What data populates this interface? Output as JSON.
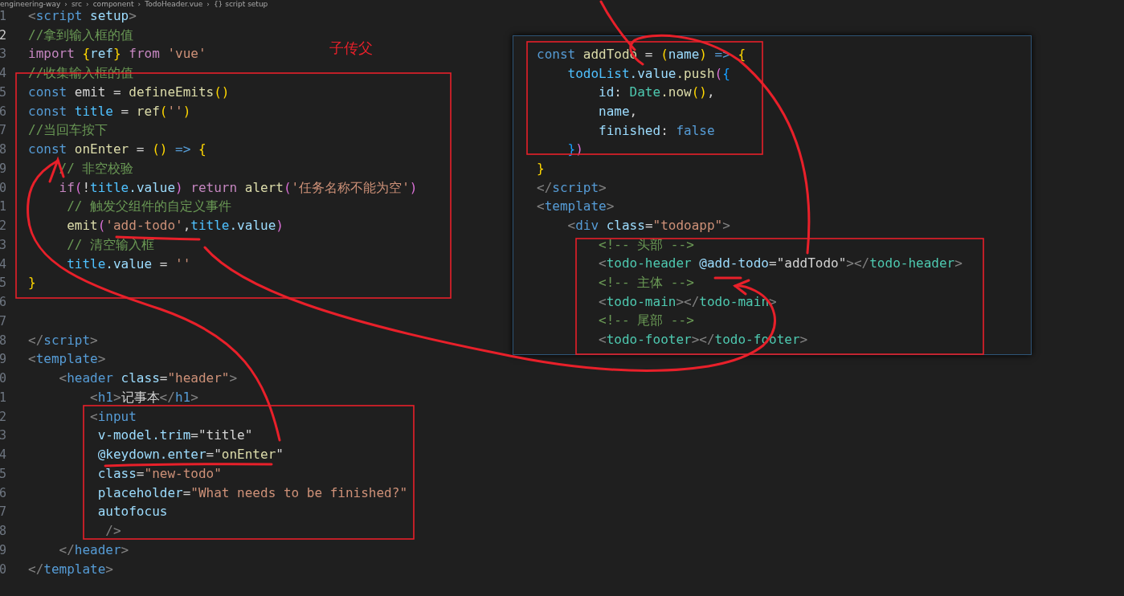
{
  "breadcrumb": {
    "separator": "›",
    "items": [
      "engineering-way",
      "src",
      "component",
      "TodoHeader.vue",
      "{} script setup"
    ]
  },
  "editor": {
    "lines": [
      {
        "n": "1",
        "tokens": [
          {
            "t": "<",
            "color": "#808080"
          },
          {
            "t": "script",
            "color": "#569cd6"
          },
          {
            "t": " setup",
            "color": "#9cdcfe"
          },
          {
            "t": ">",
            "color": "#808080"
          }
        ]
      },
      {
        "n": "2",
        "tokens": [
          {
            "t": "//拿到输入框的值",
            "color": "#6a9955"
          }
        ]
      },
      {
        "n": "3",
        "tokens": [
          {
            "t": "import",
            "color": "#c586c0"
          },
          {
            "t": " {",
            "color": "#ffd700"
          },
          {
            "t": "ref",
            "color": "#9cdcfe"
          },
          {
            "t": "}",
            "color": "#ffd700"
          },
          {
            "t": " from",
            "color": "#c586c0"
          },
          {
            "t": " 'vue'",
            "color": "#ce9178"
          }
        ]
      },
      {
        "n": "4",
        "tokens": [
          {
            "t": "//收集输入框的值",
            "color": "#6a9955"
          }
        ]
      },
      {
        "n": "5",
        "tokens": [
          {
            "t": "const",
            "color": "#569cd6"
          },
          {
            "t": " emit =",
            "color": "#d4d4d4"
          },
          {
            "t": " defineEmits",
            "color": "#dcdcaa"
          },
          {
            "t": "()",
            "color": "#ffd700"
          }
        ]
      },
      {
        "n": "6",
        "tokens": [
          {
            "t": "const",
            "color": "#569cd6"
          },
          {
            "t": " title",
            "color": "#4fc1ff"
          },
          {
            "t": " =",
            "color": "#d4d4d4"
          },
          {
            "t": " ref",
            "color": "#dcdcaa"
          },
          {
            "t": "(",
            "color": "#ffd700"
          },
          {
            "t": "''",
            "color": "#ce9178"
          },
          {
            "t": ")",
            "color": "#ffd700"
          }
        ]
      },
      {
        "n": "7",
        "tokens": [
          {
            "t": "//当回车按下",
            "color": "#6a9955"
          }
        ]
      },
      {
        "n": "8",
        "tokens": [
          {
            "t": "const",
            "color": "#569cd6"
          },
          {
            "t": " onEnter",
            "color": "#dcdcaa"
          },
          {
            "t": " =",
            "color": "#d4d4d4"
          },
          {
            "t": " ()",
            "color": "#ffd700"
          },
          {
            "t": " =>",
            "color": "#569cd6"
          },
          {
            "t": " {",
            "color": "#ffd700"
          }
        ]
      },
      {
        "n": "9",
        "tokens": [
          {
            "t": "    // 非空校验",
            "color": "#6a9955"
          }
        ]
      },
      {
        "n": "0",
        "tokens": [
          {
            "t": "    if",
            "color": "#c586c0"
          },
          {
            "t": "(",
            "color": "#da70d6"
          },
          {
            "t": "!",
            "color": "#d4d4d4"
          },
          {
            "t": "title",
            "color": "#4fc1ff"
          },
          {
            "t": ".value",
            "color": "#9cdcfe"
          },
          {
            "t": ")",
            "color": "#da70d6"
          },
          {
            "t": " return",
            "color": "#c586c0"
          },
          {
            "t": " alert",
            "color": "#dcdcaa"
          },
          {
            "t": "(",
            "color": "#da70d6"
          },
          {
            "t": "'任务名称不能为空'",
            "color": "#ce9178"
          },
          {
            "t": ")",
            "color": "#da70d6"
          }
        ]
      },
      {
        "n": "1",
        "tokens": [
          {
            "t": "     // 触发父组件的自定义事件",
            "color": "#6a9955"
          }
        ]
      },
      {
        "n": "2",
        "tokens": [
          {
            "t": "     emit",
            "color": "#dcdcaa"
          },
          {
            "t": "(",
            "color": "#da70d6"
          },
          {
            "t": "'add-todo'",
            "color": "#ce9178"
          },
          {
            "t": ",",
            "color": "#d4d4d4"
          },
          {
            "t": "title",
            "color": "#4fc1ff"
          },
          {
            "t": ".value",
            "color": "#9cdcfe"
          },
          {
            "t": ")",
            "color": "#da70d6"
          }
        ]
      },
      {
        "n": "3",
        "tokens": [
          {
            "t": "     // 清空输入框",
            "color": "#6a9955"
          }
        ]
      },
      {
        "n": "4",
        "tokens": [
          {
            "t": "     title",
            "color": "#4fc1ff"
          },
          {
            "t": ".value",
            "color": "#9cdcfe"
          },
          {
            "t": " =",
            "color": "#d4d4d4"
          },
          {
            "t": " ''",
            "color": "#ce9178"
          }
        ]
      },
      {
        "n": "5",
        "tokens": [
          {
            "t": "}",
            "color": "#ffd700"
          }
        ]
      },
      {
        "n": "6"
      },
      {
        "n": "7"
      },
      {
        "n": "8",
        "tokens": [
          {
            "t": "</",
            "color": "#808080"
          },
          {
            "t": "script",
            "color": "#569cd6"
          },
          {
            "t": ">",
            "color": "#808080"
          }
        ]
      },
      {
        "n": "9",
        "tokens": [
          {
            "t": "<",
            "color": "#808080"
          },
          {
            "t": "template",
            "color": "#569cd6"
          },
          {
            "t": ">",
            "color": "#808080"
          }
        ]
      },
      {
        "n": "0",
        "tokens": [
          {
            "t": "    <",
            "color": "#808080"
          },
          {
            "t": "header",
            "color": "#569cd6"
          },
          {
            "t": " class",
            "color": "#9cdcfe"
          },
          {
            "t": "=",
            "color": "#d4d4d4"
          },
          {
            "t": "\"header\"",
            "color": "#ce9178"
          },
          {
            "t": ">",
            "color": "#808080"
          }
        ]
      },
      {
        "n": "1",
        "tokens": [
          {
            "t": "        <",
            "color": "#808080"
          },
          {
            "t": "h1",
            "color": "#569cd6"
          },
          {
            "t": ">",
            "color": "#808080"
          },
          {
            "t": "记事本",
            "color": "#d4d4d4"
          },
          {
            "t": "</",
            "color": "#808080"
          },
          {
            "t": "h1",
            "color": "#569cd6"
          },
          {
            "t": ">",
            "color": "#808080"
          }
        ]
      },
      {
        "n": "2",
        "tokens": [
          {
            "t": "        <",
            "color": "#808080"
          },
          {
            "t": "input",
            "color": "#569cd6"
          }
        ]
      },
      {
        "n": "3",
        "tokens": [
          {
            "t": "         v-model.trim",
            "color": "#9cdcfe"
          },
          {
            "t": "=\"title\"",
            "color": "#d4d4d4"
          }
        ]
      },
      {
        "n": "4",
        "tokens": [
          {
            "t": "         @keydown.enter",
            "color": "#9cdcfe"
          },
          {
            "t": "=\"",
            "color": "#d4d4d4"
          },
          {
            "t": "onEnter",
            "color": "#dcdcaa"
          },
          {
            "t": "\"",
            "color": "#d4d4d4"
          }
        ]
      },
      {
        "n": "5",
        "tokens": [
          {
            "t": "         class",
            "color": "#9cdcfe"
          },
          {
            "t": "=",
            "color": "#d4d4d4"
          },
          {
            "t": "\"new-todo\"",
            "color": "#ce9178"
          }
        ]
      },
      {
        "n": "6",
        "tokens": [
          {
            "t": "         placeholder",
            "color": "#9cdcfe"
          },
          {
            "t": "=",
            "color": "#d4d4d4"
          },
          {
            "t": "\"What needs to be finished?\"",
            "color": "#ce9178"
          }
        ]
      },
      {
        "n": "7",
        "tokens": [
          {
            "t": "         autofocus",
            "color": "#9cdcfe"
          }
        ]
      },
      {
        "n": "8",
        "tokens": [
          {
            "t": "          />",
            "color": "#808080"
          }
        ]
      },
      {
        "n": "9",
        "tokens": [
          {
            "t": "    </",
            "color": "#808080"
          },
          {
            "t": "header",
            "color": "#569cd6"
          },
          {
            "t": ">",
            "color": "#808080"
          }
        ]
      },
      {
        "n": "0",
        "tokens": [
          {
            "t": "</",
            "color": "#808080"
          },
          {
            "t": "template",
            "color": "#569cd6"
          },
          {
            "t": ">",
            "color": "#808080"
          }
        ]
      }
    ]
  },
  "peek_panel": {
    "lines": [
      {
        "tokens": [
          {
            "t": "const",
            "color": "#569cd6"
          },
          {
            "t": " addTodo",
            "color": "#dcdcaa"
          },
          {
            "t": " =",
            "color": "#d4d4d4"
          },
          {
            "t": " (",
            "color": "#ffd700"
          },
          {
            "t": "name",
            "color": "#9cdcfe"
          },
          {
            "t": ")",
            "color": "#ffd700"
          },
          {
            "t": " =>",
            "color": "#569cd6"
          },
          {
            "t": " {",
            "color": "#ffd700"
          }
        ]
      },
      {
        "tokens": [
          {
            "t": "    todoList",
            "color": "#4fc1ff"
          },
          {
            "t": ".value",
            "color": "#9cdcfe"
          },
          {
            "t": ".push",
            "color": "#dcdcaa"
          },
          {
            "t": "(",
            "color": "#da70d6"
          },
          {
            "t": "{",
            "color": "#179fff"
          }
        ]
      },
      {
        "tokens": [
          {
            "t": "        id",
            "color": "#9cdcfe"
          },
          {
            "t": ":",
            "color": "#d4d4d4"
          },
          {
            "t": " Date",
            "color": "#4ec9b0"
          },
          {
            "t": ".now",
            "color": "#dcdcaa"
          },
          {
            "t": "()",
            "color": "#ffd700"
          },
          {
            "t": ",",
            "color": "#d4d4d4"
          }
        ]
      },
      {
        "tokens": [
          {
            "t": "        name",
            "color": "#9cdcfe"
          },
          {
            "t": ",",
            "color": "#d4d4d4"
          }
        ]
      },
      {
        "tokens": [
          {
            "t": "        finished",
            "color": "#9cdcfe"
          },
          {
            "t": ":",
            "color": "#d4d4d4"
          },
          {
            "t": " false",
            "color": "#569cd6"
          }
        ]
      },
      {
        "tokens": [
          {
            "t": "    }",
            "color": "#179fff"
          },
          {
            "t": ")",
            "color": "#da70d6"
          }
        ]
      },
      {
        "tokens": [
          {
            "t": "}",
            "color": "#ffd700"
          }
        ]
      },
      {
        "tokens": [
          {
            "t": "</",
            "color": "#808080"
          },
          {
            "t": "script",
            "color": "#569cd6"
          },
          {
            "t": ">",
            "color": "#808080"
          }
        ]
      },
      {
        "tokens": [
          {
            "t": "<",
            "color": "#808080"
          },
          {
            "t": "template",
            "color": "#569cd6"
          },
          {
            "t": ">",
            "color": "#808080"
          }
        ]
      },
      {
        "tokens": [
          {
            "t": "    <",
            "color": "#808080"
          },
          {
            "t": "div",
            "color": "#569cd6"
          },
          {
            "t": " class",
            "color": "#9cdcfe"
          },
          {
            "t": "=",
            "color": "#d4d4d4"
          },
          {
            "t": "\"todoapp\"",
            "color": "#ce9178"
          },
          {
            "t": ">",
            "color": "#808080"
          }
        ]
      },
      {
        "tokens": [
          {
            "t": "        <!-- 头部 -->",
            "color": "#6a9955"
          }
        ]
      },
      {
        "tokens": [
          {
            "t": "        <",
            "color": "#808080"
          },
          {
            "t": "todo-header",
            "color": "#4ec9b0"
          },
          {
            "t": " @add-todo",
            "color": "#9cdcfe"
          },
          {
            "t": "=\"addTodo\"",
            "color": "#d4d4d4"
          },
          {
            "t": "></",
            "color": "#808080"
          },
          {
            "t": "todo-header",
            "color": "#4ec9b0"
          },
          {
            "t": ">",
            "color": "#808080"
          }
        ]
      },
      {
        "tokens": [
          {
            "t": "        <!-- 主体 -->",
            "color": "#6a9955"
          }
        ]
      },
      {
        "tokens": [
          {
            "t": "        <",
            "color": "#808080"
          },
          {
            "t": "todo-main",
            "color": "#4ec9b0"
          },
          {
            "t": "></",
            "color": "#808080"
          },
          {
            "t": "todo-main",
            "color": "#4ec9b0"
          },
          {
            "t": ">",
            "color": "#808080"
          }
        ]
      },
      {
        "tokens": [
          {
            "t": "        <!-- 尾部 -->",
            "color": "#6a9955"
          }
        ]
      },
      {
        "tokens": [
          {
            "t": "        <",
            "color": "#808080"
          },
          {
            "t": "todo-footer",
            "color": "#4ec9b0"
          },
          {
            "t": "></",
            "color": "#808080"
          },
          {
            "t": "todo-footer",
            "color": "#4ec9b0"
          },
          {
            "t": ">",
            "color": "#808080"
          }
        ]
      }
    ]
  },
  "annotation": {
    "label": "子传父"
  }
}
